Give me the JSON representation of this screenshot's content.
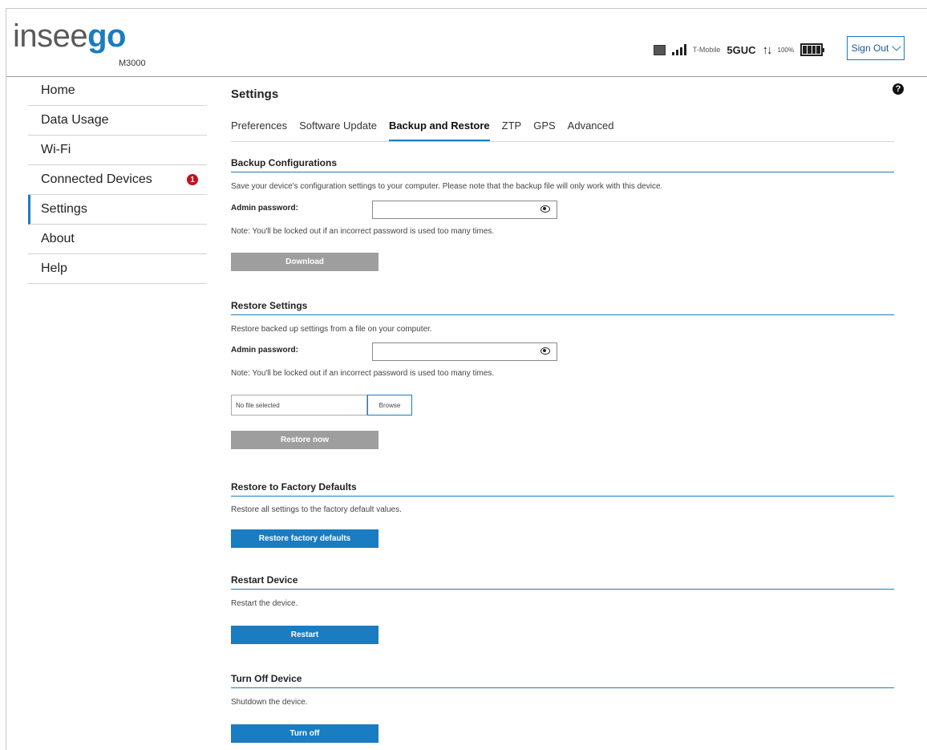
{
  "brand": {
    "logo_light": "insee",
    "logo_bold": "go",
    "model": "M3000"
  },
  "status": {
    "carrier": "T-Mobile",
    "network": "5GUC",
    "arrows": "↑↓",
    "battery_percent": "100%"
  },
  "header": {
    "signout_label": "Sign Out"
  },
  "sidebar": {
    "items": [
      {
        "label": "Home"
      },
      {
        "label": "Data Usage"
      },
      {
        "label": "Wi-Fi"
      },
      {
        "label": "Connected Devices",
        "badge": "1"
      },
      {
        "label": "Settings",
        "active": true
      },
      {
        "label": "About"
      },
      {
        "label": "Help"
      }
    ]
  },
  "main": {
    "title": "Settings",
    "help_icon": "?",
    "tabs": [
      {
        "label": "Preferences"
      },
      {
        "label": "Software Update"
      },
      {
        "label": "Backup and Restore",
        "active": true
      },
      {
        "label": "ZTP"
      },
      {
        "label": "GPS"
      },
      {
        "label": "Advanced"
      }
    ]
  },
  "backup": {
    "title": "Backup Configurations",
    "desc": "Save your device's configuration settings to your computer. Please note that the backup file will only work with this device.",
    "pw_label": "Admin password:",
    "pw_value": "",
    "note": "Note: You'll be locked out if an incorrect password is used too many times.",
    "button": "Download"
  },
  "restore": {
    "title": "Restore Settings",
    "desc": "Restore backed up settings from a file on your computer.",
    "pw_label": "Admin password:",
    "pw_value": "",
    "note": "Note: You'll be locked out if an incorrect password is used too many times.",
    "file_text": "No file selected",
    "browse_label": "Browse",
    "button": "Restore now"
  },
  "factory": {
    "title": "Restore to Factory Defaults",
    "desc": "Restore all settings to the factory default values.",
    "button": "Restore factory defaults"
  },
  "restart": {
    "title": "Restart Device",
    "desc": "Restart the device.",
    "button": "Restart"
  },
  "turnoff": {
    "title": "Turn Off Device",
    "desc": "Shutdown the device.",
    "button": "Turn off"
  },
  "colors": {
    "accent": "#1a7cc1",
    "badge": "#c8101e",
    "disabled_button": "#9e9e9e"
  }
}
